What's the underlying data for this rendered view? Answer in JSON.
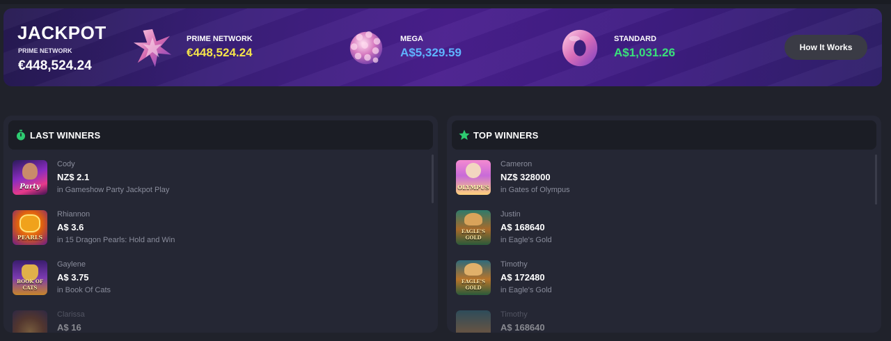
{
  "jackpot": {
    "title": "JACKPOT",
    "subtitle": "PRIME NETWORK",
    "amount": "€448,524.24",
    "items": [
      {
        "name": "PRIME NETWORK",
        "value": "€448,524.24",
        "color": "#f5e34a",
        "icon": "crystal-star-icon"
      },
      {
        "name": "MEGA",
        "value": "A$5,329.59",
        "color": "#5fb4ff",
        "icon": "crystal-ball-icon"
      },
      {
        "name": "STANDARD",
        "value": "A$1,031.26",
        "color": "#39e07a",
        "icon": "torus-ring-icon"
      }
    ],
    "how_button": "How It Works"
  },
  "last_winners": {
    "title": "LAST WINNERS",
    "icon": "stopwatch-icon",
    "accent": "#2ecc71",
    "rows": [
      {
        "user": "Cody",
        "amount": "NZ$ 2.1",
        "game": "in Gameshow Party Jackpot Play",
        "thumb_text": "Party"
      },
      {
        "user": "Rhiannon",
        "amount": "A$ 3.6",
        "game": "in 15 Dragon Pearls: Hold and Win",
        "thumb_text": "PEARLS"
      },
      {
        "user": "Gaylene",
        "amount": "A$ 3.75",
        "game": "in Book Of Cats",
        "thumb_text": "BOOK OF CATS"
      },
      {
        "user": "Clarissa",
        "amount": "A$ 16",
        "game": "",
        "thumb_text": ""
      }
    ]
  },
  "top_winners": {
    "title": "TOP WINNERS",
    "icon": "star-icon",
    "accent": "#2ecc71",
    "rows": [
      {
        "user": "Cameron",
        "amount": "NZ$ 328000",
        "game": "in Gates of Olympus",
        "thumb_text": "OLYMPUS"
      },
      {
        "user": "Justin",
        "amount": "A$ 168640",
        "game": "in Eagle's Gold",
        "thumb_text": "EAGLE'S GOLD"
      },
      {
        "user": "Timothy",
        "amount": "A$ 172480",
        "game": "in Eagle's Gold",
        "thumb_text": "EAGLE'S GOLD"
      },
      {
        "user": "Timothy",
        "amount": "A$ 168640",
        "game": "",
        "thumb_text": ""
      }
    ]
  }
}
